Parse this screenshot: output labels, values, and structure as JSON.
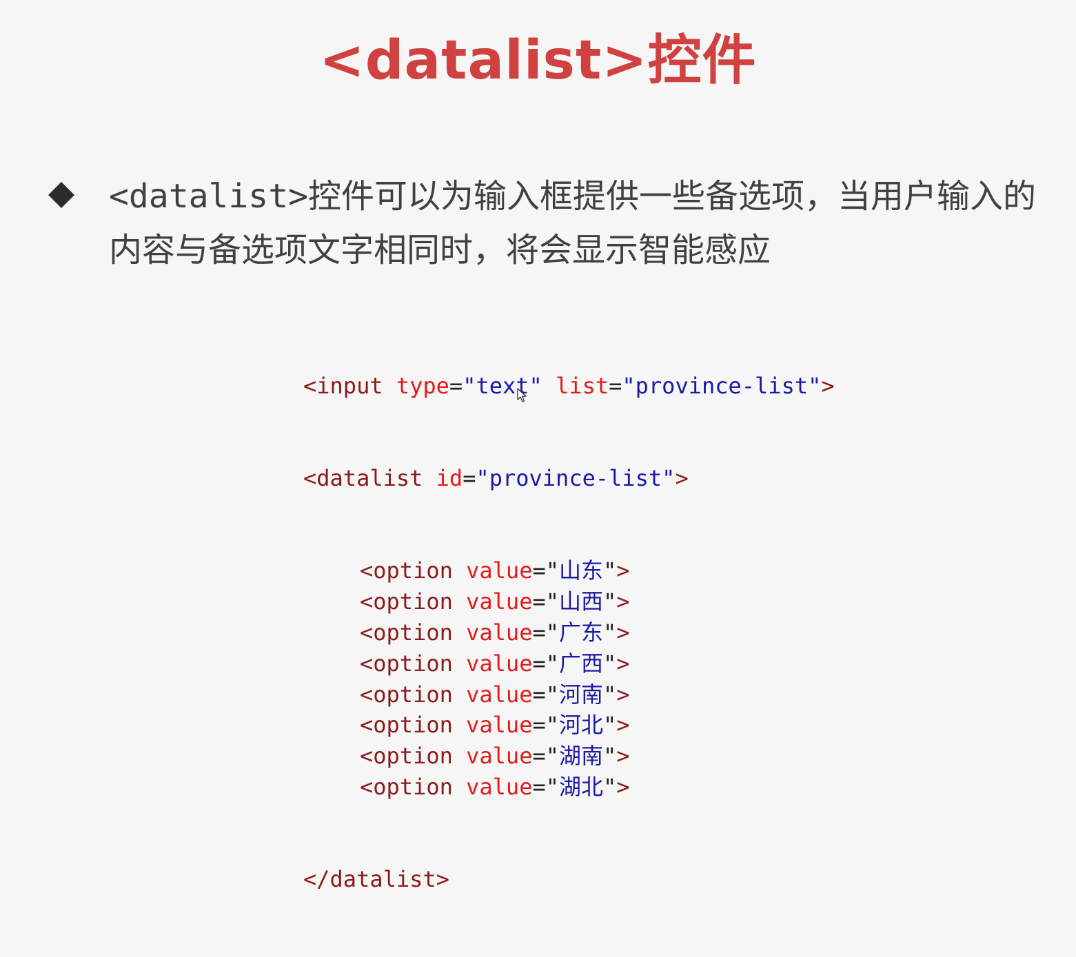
{
  "slide": {
    "title": "<datalist>控件",
    "bullet": {
      "tag": "<datalist>",
      "text": "控件可以为输入框提供一些备选项，当用户输入的内容与备选项文字相同时，将会显示智能感应"
    },
    "code": {
      "input_line": {
        "open": "<input",
        "attr1": "type",
        "val1": "\"text\"",
        "attr2": "list",
        "val2": "\"province-list\"",
        "close": ">"
      },
      "datalist_open": {
        "open": "<datalist",
        "attr": "id",
        "val": "\"province-list\"",
        "close": ">"
      },
      "option_tag": "<option",
      "option_attr": "value",
      "options": [
        "山东",
        "山西",
        "广东",
        "广西",
        "河南",
        "河北",
        "湖南",
        "湖北"
      ],
      "datalist_close": "</datalist>"
    },
    "colors": {
      "title": "#d0423f",
      "body_text": "#404040",
      "tag": "#8b1a1a",
      "attribute": "#e31a1a",
      "string": "#1a1aa6",
      "background": "#f6f6f6"
    }
  }
}
